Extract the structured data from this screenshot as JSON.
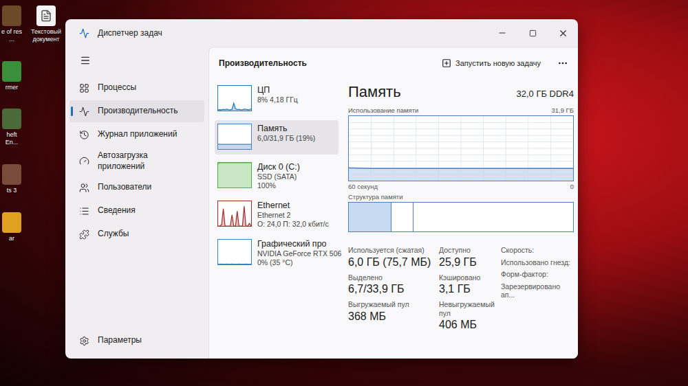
{
  "desktop": {
    "icons_left": [
      {
        "label": "e of res ...",
        "color": "#6b4a2a"
      },
      {
        "label": "rmer",
        "color": "#3a8f3a"
      },
      {
        "label": "heft En...",
        "color": "#4a6a3a"
      },
      {
        "label": "ts 3",
        "color": "#7a4a3a"
      },
      {
        "label": "ar",
        "color": "#e0a020"
      }
    ],
    "icons_right": [
      {
        "label": "Текстовый документ",
        "color": "#f4f4f4"
      }
    ]
  },
  "window": {
    "title": "Диспетчер задач"
  },
  "sidebar": {
    "items": [
      {
        "label": "Процессы",
        "selected": false
      },
      {
        "label": "Производительность",
        "selected": true
      },
      {
        "label": "Журнал приложений",
        "selected": false
      },
      {
        "label": "Автозагрузка приложений",
        "selected": false
      },
      {
        "label": "Пользователи",
        "selected": false
      },
      {
        "label": "Сведения",
        "selected": false
      },
      {
        "label": "Службы",
        "selected": false
      }
    ],
    "settings": "Параметры"
  },
  "header": {
    "title": "Производительность",
    "new_task": "Запустить новую задачу"
  },
  "devices": [
    {
      "name": "ЦП",
      "lines": [
        "8% 4,18 ГГц"
      ],
      "selected": false,
      "color": "#1f7bb8",
      "values": [
        3,
        4,
        3,
        5,
        4,
        6,
        4,
        3,
        5,
        30,
        8,
        4,
        5,
        3,
        4,
        6,
        5,
        4,
        3,
        8
      ]
    },
    {
      "name": "Память",
      "lines": [
        "6,0/31,9 ГБ (19%)"
      ],
      "selected": true,
      "color": "#4a7fc1",
      "values": [
        20,
        19,
        19,
        19,
        19,
        19,
        19,
        19,
        19,
        19,
        19,
        19,
        19,
        19,
        19,
        19,
        19,
        19,
        19,
        19
      ]
    },
    {
      "name": "Диск 0 (C:)",
      "lines": [
        "SSD (SATA)",
        "100%"
      ],
      "selected": false,
      "color": "#4caf3a",
      "values": [
        95,
        100,
        100,
        100,
        100,
        100,
        100,
        100,
        100,
        100,
        100,
        100,
        100,
        100,
        100,
        100,
        100,
        100,
        100,
        100
      ]
    },
    {
      "name": "Ethernet",
      "lines": [
        "Ethernet 2",
        "О: 24,0 П: 32,0 кбит/с"
      ],
      "selected": false,
      "color": "#a52a2a",
      "values": [
        0,
        0,
        5,
        70,
        0,
        0,
        0,
        0,
        45,
        0,
        0,
        60,
        0,
        0,
        0,
        80,
        0,
        0,
        10,
        0
      ]
    },
    {
      "name": "Графический про",
      "lines": [
        "NVIDIA GeForce RTX 506",
        "0% (35 °C)"
      ],
      "selected": false,
      "color": "#3b7fc4",
      "values": [
        2,
        1,
        2,
        1,
        1,
        2,
        1,
        1,
        2,
        1,
        1,
        1,
        2,
        1,
        1,
        1,
        2,
        1,
        1,
        1
      ]
    }
  ],
  "memory": {
    "title": "Память",
    "total": "32,0 ГБ DDR4",
    "usage_chart": {
      "label": "Использование памяти",
      "max_label": "31,9 ГБ",
      "axis_max": 31.9,
      "x_label": "60 секунд",
      "min_label": "0",
      "values": [
        6.3,
        6.2,
        6.1,
        6.0,
        6.0,
        6.0,
        6.0,
        6.0,
        6.0,
        6.0,
        6.0,
        6.0,
        6.0,
        6.0,
        6.0,
        6.0,
        6.0,
        6.0,
        6.0,
        6.0,
        6.0,
        6.0,
        6.0,
        6.0,
        6.0,
        6.0,
        6.0,
        6.0,
        6.0,
        6.0
      ]
    },
    "composition": {
      "label": "Структура памяти",
      "segments": [
        {
          "kind": "in_use",
          "level": 0.19
        },
        {
          "kind": "standby",
          "level": 0.097
        },
        {
          "kind": "free",
          "level": 0.713
        }
      ]
    },
    "stats": [
      {
        "label": "Используется (сжатая)",
        "value": "6,0 ГБ (75,7 МБ)"
      },
      {
        "label": "Доступно",
        "value": "25,9 ГБ"
      },
      {
        "label": "Выделено",
        "value": "6,7/33,9 ГБ"
      },
      {
        "label": "Кэшировано",
        "value": "3,1 ГБ"
      },
      {
        "label": "Выгружаемый пул",
        "value": "368 МБ"
      },
      {
        "label": "Невыгружаемый пул",
        "value": "406 МБ"
      }
    ],
    "info": [
      "Скорость:",
      "Использовано гнезд:",
      "Форм-фактор:",
      "Зарезервировано ап..."
    ]
  }
}
